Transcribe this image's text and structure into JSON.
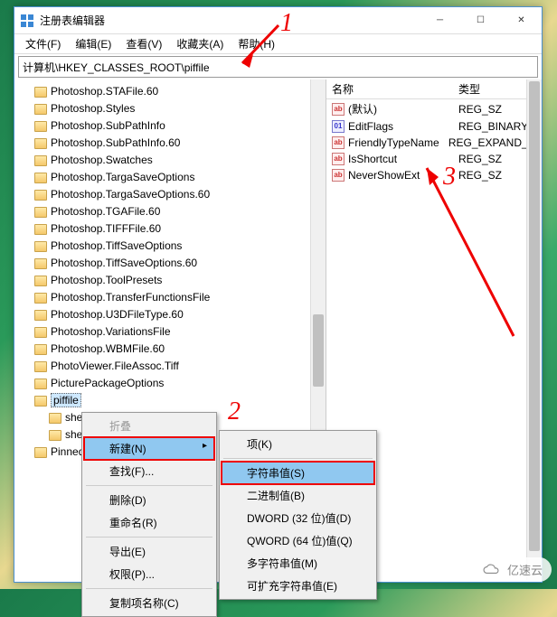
{
  "titlebar": {
    "title": "注册表编辑器"
  },
  "menus": {
    "file": "文件(F)",
    "edit": "编辑(E)",
    "view": "查看(V)",
    "fav": "收藏夹(A)",
    "help": "帮助(H)"
  },
  "address": "计算机\\HKEY_CLASSES_ROOT\\piffile",
  "tree": [
    "Photoshop.STAFile.60",
    "Photoshop.Styles",
    "Photoshop.SubPathInfo",
    "Photoshop.SubPathInfo.60",
    "Photoshop.Swatches",
    "Photoshop.TargaSaveOptions",
    "Photoshop.TargaSaveOptions.60",
    "Photoshop.TGAFile.60",
    "Photoshop.TIFFFile.60",
    "Photoshop.TiffSaveOptions",
    "Photoshop.TiffSaveOptions.60",
    "Photoshop.ToolPresets",
    "Photoshop.TransferFunctionsFile",
    "Photoshop.U3DFileType.60",
    "Photoshop.VariationsFile",
    "Photoshop.WBMFile.60",
    "PhotoViewer.FileAssoc.Tiff",
    "PicturePackageOptions"
  ],
  "tree_selected": "piffile",
  "tree_children": [
    "shell",
    "shellex"
  ],
  "tree_after": "PinnedFrequencyHelper",
  "columns": {
    "name": "名称",
    "type": "类型"
  },
  "values": [
    {
      "name": "(默认)",
      "type": "REG_SZ",
      "icon": "str"
    },
    {
      "name": "EditFlags",
      "type": "REG_BINARY",
      "icon": "bin"
    },
    {
      "name": "FriendlyTypeName",
      "type": "REG_EXPAND_SZ",
      "icon": "str"
    },
    {
      "name": "IsShortcut",
      "type": "REG_SZ",
      "icon": "str"
    },
    {
      "name": "NeverShowExt",
      "type": "REG_SZ",
      "icon": "str"
    }
  ],
  "ctx1": {
    "collapse": "折叠",
    "new": "新建(N)",
    "find": "查找(F)...",
    "delete": "删除(D)",
    "rename": "重命名(R)",
    "export": "导出(E)",
    "perm": "权限(P)...",
    "copykey": "复制项名称(C)"
  },
  "ctx2": {
    "key": "项(K)",
    "string": "字符串值(S)",
    "binary": "二进制值(B)",
    "dword": "DWORD (32 位)值(D)",
    "qword": "QWORD (64 位)值(Q)",
    "multi": "多字符串值(M)",
    "expand": "可扩充字符串值(E)"
  },
  "annotations": {
    "n1": "1",
    "n2": "2",
    "n3": "3"
  },
  "watermark": "亿速云"
}
